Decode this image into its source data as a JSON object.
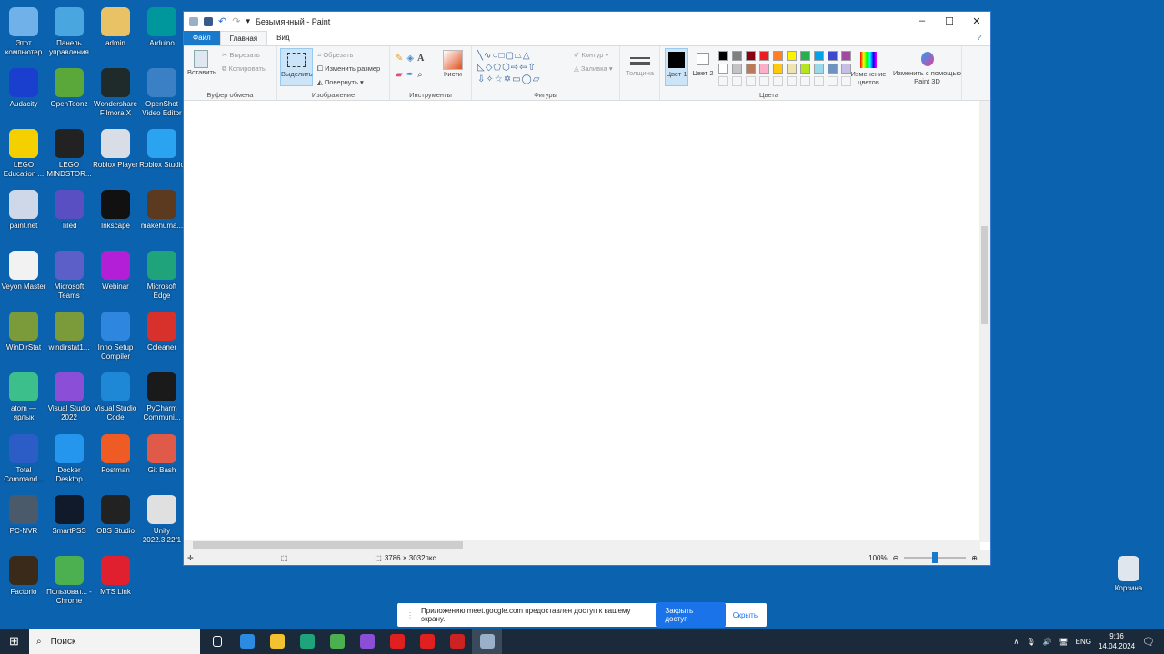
{
  "desktop": {
    "icons": [
      {
        "label": "Этот компьютер",
        "color": "#6fb1e8"
      },
      {
        "label": "Панель управления",
        "color": "#4aa6de"
      },
      {
        "label": "admin",
        "color": "#e8c265"
      },
      {
        "label": "Arduino",
        "color": "#00979c"
      },
      {
        "label": "Audacity",
        "color": "#1a3fcf"
      },
      {
        "label": "OpenToonz",
        "color": "#5aa83a"
      },
      {
        "label": "Wondershare Filmora X",
        "color": "#1f2a2a"
      },
      {
        "label": "OpenShot Video Editor",
        "color": "#3b7fc4"
      },
      {
        "label": "LEGO Education ...",
        "color": "#f5d000"
      },
      {
        "label": "LEGO MINDSTOR...",
        "color": "#222222"
      },
      {
        "label": "Roblox Player",
        "color": "#d9dee6"
      },
      {
        "label": "Roblox Studio",
        "color": "#2aa3f0"
      },
      {
        "label": "paint.net",
        "color": "#cfd8e8"
      },
      {
        "label": "Tiled",
        "color": "#5a4fc2"
      },
      {
        "label": "Inkscape",
        "color": "#111111"
      },
      {
        "label": "makehuma...",
        "color": "#5b3a1f"
      },
      {
        "label": "Veyon Master",
        "color": "#f2f2f2"
      },
      {
        "label": "Microsoft Teams",
        "color": "#5b5fc7"
      },
      {
        "label": "Webinar",
        "color": "#b21fd6"
      },
      {
        "label": "Microsoft Edge",
        "color": "#1fa37a"
      },
      {
        "label": "WinDirStat",
        "color": "#7b9a3a"
      },
      {
        "label": "windirstat1...",
        "color": "#7b9a3a"
      },
      {
        "label": "Inno Setup Compiler",
        "color": "#2e86de"
      },
      {
        "label": "Ccleaner",
        "color": "#d8302a"
      },
      {
        "label": "atom — ярлык",
        "color": "#3cbf8a"
      },
      {
        "label": "Visual Studio 2022",
        "color": "#8a4fd6"
      },
      {
        "label": "Visual Studio Code",
        "color": "#1e88d6"
      },
      {
        "label": "PyCharm Communi...",
        "color": "#1a1a1a"
      },
      {
        "label": "Total Command...",
        "color": "#2c5cc5"
      },
      {
        "label": "Docker Desktop",
        "color": "#2496ed"
      },
      {
        "label": "Postman",
        "color": "#ef5b25"
      },
      {
        "label": "Git Bash",
        "color": "#e05a4a"
      },
      {
        "label": "PC-NVR",
        "color": "#4a5a6a"
      },
      {
        "label": "SmartPSS",
        "color": "#111a2a"
      },
      {
        "label": "OBS Studio",
        "color": "#222222"
      },
      {
        "label": "Unity 2022.3.22f1",
        "color": "#e0e0e0"
      },
      {
        "label": "Factorio",
        "color": "#3a2a1a"
      },
      {
        "label": "Пользоват... - Chrome",
        "color": "#4caf50"
      },
      {
        "label": "MTS Link",
        "color": "#e0202e"
      }
    ],
    "recycle_bin": "Корзина"
  },
  "paint": {
    "title": "Безымянный - Paint",
    "tabs": {
      "file": "Файл",
      "home": "Главная",
      "view": "Вид"
    },
    "clipboard": {
      "paste": "Вставить",
      "cut": "Вырезать",
      "copy": "Копировать",
      "label": "Буфер обмена"
    },
    "image": {
      "select": "Выделить",
      "crop": "Обрезать",
      "resize": "Изменить размер",
      "rotate": "Повернуть",
      "label": "Изображение"
    },
    "tools": {
      "brushes": "Кисти",
      "label": "Инструменты"
    },
    "shapes": {
      "outline": "Контур",
      "fill": "Заливка",
      "label": "Фигуры"
    },
    "size": "Толщина",
    "colors": {
      "color1": "Цвет 1",
      "color2": "Цвет 2",
      "edit": "Изменение цветов",
      "label": "Цвета",
      "palette": [
        "#000000",
        "#7f7f7f",
        "#880015",
        "#ed1c24",
        "#ff7f27",
        "#fff200",
        "#22b14c",
        "#00a2e8",
        "#3f48cc",
        "#a349a4",
        "#ffffff",
        "#c3c3c3",
        "#b97a57",
        "#ffaec9",
        "#ffc90e",
        "#efe4b0",
        "#b5e61d",
        "#99d9ea",
        "#7092be",
        "#c8bfe7"
      ]
    },
    "paint3d": "Изменить с помощью Paint 3D",
    "status": {
      "dimensions": "3786 × 3032пкс",
      "zoom": "100%",
      "zoom_fraction": 0.5
    }
  },
  "notification": {
    "text": "Приложению meet.google.com предоставлен доступ к вашему экрану.",
    "stop": "Закрыть доступ",
    "hide": "Скрыть"
  },
  "taskbar": {
    "search": "Поиск",
    "lang": "ENG",
    "time": "9:16",
    "date": "14.04.2024",
    "apps": [
      {
        "name": "task-view",
        "color": "#ffffff"
      },
      {
        "name": "store",
        "color": "#2a8be0"
      },
      {
        "name": "explorer",
        "color": "#f2c230"
      },
      {
        "name": "edge",
        "color": "#1fa37a"
      },
      {
        "name": "chrome",
        "color": "#4caf50"
      },
      {
        "name": "visual-studio",
        "color": "#8a4fd6"
      },
      {
        "name": "yandex",
        "color": "#e02020"
      },
      {
        "name": "yandex-2",
        "color": "#e02020"
      },
      {
        "name": "obs",
        "color": "#cc2222"
      },
      {
        "name": "paint",
        "color": "#9ab0c8"
      }
    ]
  }
}
